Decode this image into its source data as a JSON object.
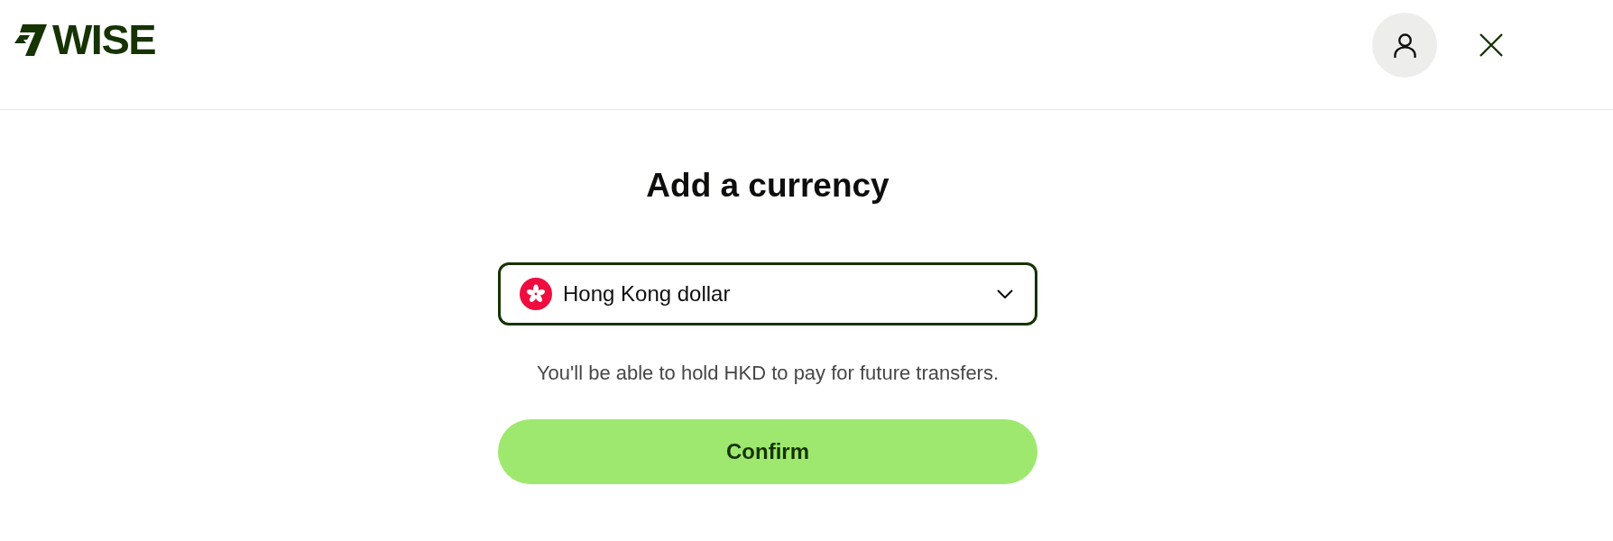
{
  "header": {
    "logo": {
      "text": "WISE"
    }
  },
  "title": "Add a currency",
  "currency_select": {
    "value": "Hong Kong dollar"
  },
  "hint": "You'll be able to hold HKD to pay for future transfers.",
  "confirm_button": {
    "label": "Confirm"
  }
}
